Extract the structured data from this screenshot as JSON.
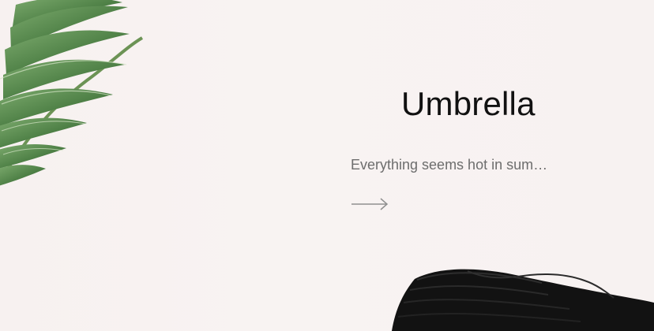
{
  "hero": {
    "title": "Umbrella",
    "description": "Everything seems hot in sum…"
  },
  "icons": {
    "next": "right-arrow-icon",
    "leaf": "palm-leaf",
    "product": "folded-umbrella"
  },
  "colors": {
    "background": "#f7f2f1",
    "title": "#111111",
    "description": "#6d6d6d",
    "arrow": "#8f8f8f",
    "leaf": "#4f7f46",
    "umbrella": "#151515"
  }
}
